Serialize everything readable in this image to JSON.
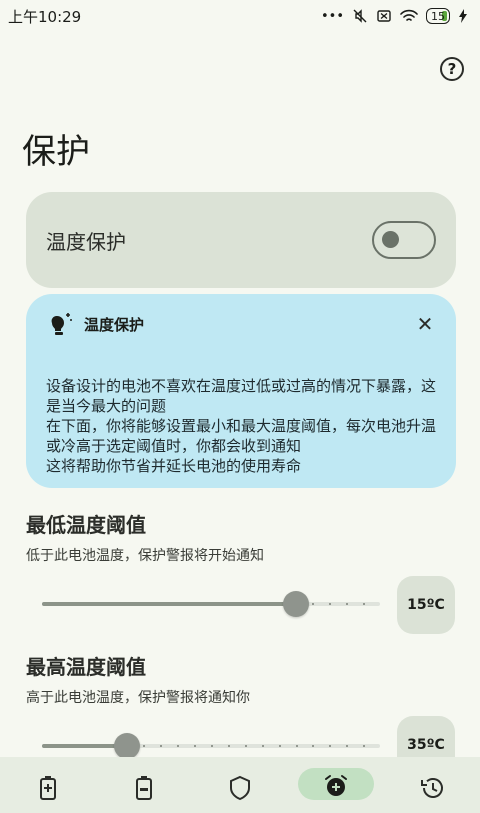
{
  "status": {
    "time": "上午10:29",
    "battery": "15"
  },
  "page": {
    "title": "保护"
  },
  "toggle": {
    "label": "温度保护",
    "enabled": false
  },
  "info": {
    "title": "温度保护",
    "body": "设备设计的电池不喜欢在温度过低或过高的情况下暴露，这是当今最大的问题\n在下面，你将能够设置最小和最大温度阈值，每次电池升温或冷高于选定阈值时，你都会收到通知\n这将帮助你节省并延长电池的使用寿命"
  },
  "min": {
    "heading": "最低温度阈值",
    "sub": "低于此电池温度，保护警报将开始通知",
    "value": "15ºC",
    "fraction": 0.75
  },
  "max": {
    "heading": "最高温度阈值",
    "sub": "高于此电池温度，保护警报将通知你",
    "value": "35ºC",
    "fraction": 0.25
  },
  "colors": {
    "background": "#f6f8f1",
    "card": "#dbe2d6",
    "info": "#bfe8f3",
    "active_pill": "#c2e0c2"
  },
  "nav": [
    {
      "icon": "battery-charging-icon"
    },
    {
      "icon": "battery-icon"
    },
    {
      "icon": "shield-icon"
    },
    {
      "icon": "alarm-add-icon",
      "active": true
    },
    {
      "icon": "history-icon"
    }
  ]
}
